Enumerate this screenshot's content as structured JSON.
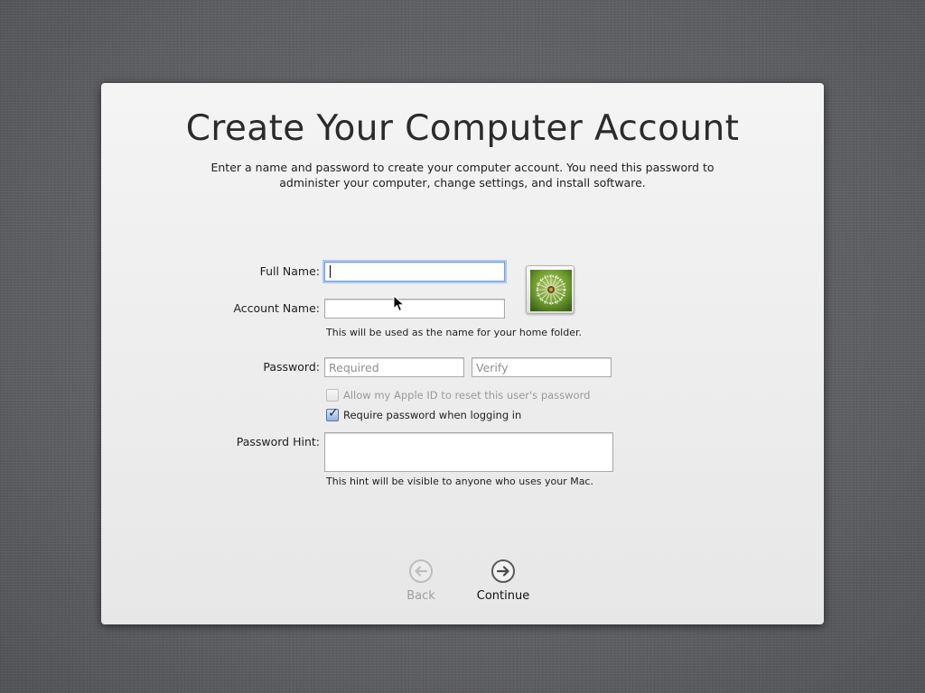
{
  "panel": {
    "title": "Create Your Computer Account",
    "subtitle_line1": "Enter a name and password to create your computer account. You need this password to",
    "subtitle_line2": "administer your computer, change settings, and install software."
  },
  "form": {
    "full_name": {
      "label": "Full Name:",
      "value": ""
    },
    "account_name": {
      "label": "Account Name:",
      "value": "",
      "note": "This will be used as the name for your home folder."
    },
    "password": {
      "label": "Password:",
      "placeholder": "Required",
      "verify_placeholder": "Verify"
    },
    "apple_id_reset": {
      "label": "Allow my Apple ID to reset this user's password",
      "checked": false,
      "enabled": false
    },
    "require_password": {
      "label": "Require password when logging in",
      "checked": true,
      "enabled": true
    },
    "hint": {
      "label": "Password Hint:",
      "value": "",
      "note": "This hint will be visible to anyone who uses your Mac."
    },
    "avatar_icon": "dandelion-picture"
  },
  "nav": {
    "back_label": "Back",
    "back_enabled": false,
    "continue_label": "Continue",
    "continue_enabled": true
  },
  "colors": {
    "focus_ring": "#a9c8f3",
    "panel_background": "#eeeeee",
    "desktop_background": "#5f6064"
  }
}
